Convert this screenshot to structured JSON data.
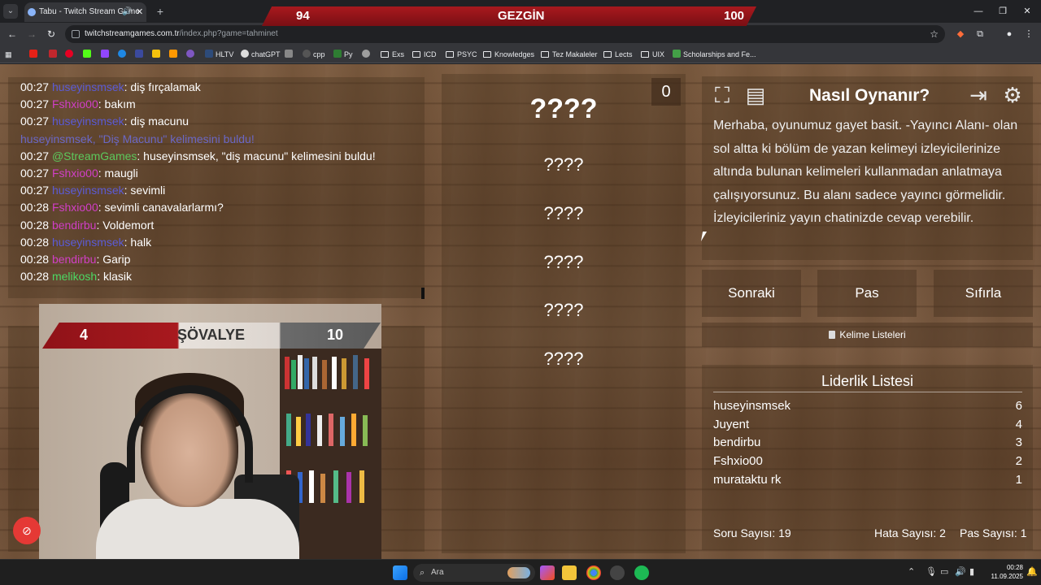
{
  "browser": {
    "tab_title": "Tabu - Twitch Stream Game",
    "url_host": "twitchstreamgames.com.tr",
    "url_path": "/index.php?game=tahminet",
    "bookmarks": [
      "HLTV",
      "chatGPT",
      "cpp",
      "Py",
      "Exs",
      "ICD",
      "PSYC",
      "Knowledges",
      "Tez Makaleler",
      "Lects",
      "UIX",
      "Scholarships and Fe..."
    ]
  },
  "top_score": {
    "left": "94",
    "title": "GEZGİN",
    "right": "100"
  },
  "chat": [
    {
      "time": "00:27",
      "user": "huseyinsmsek",
      "user_class": "u-blue",
      "sep": ":",
      "msg": " diş fırçalamak"
    },
    {
      "time": "00:27",
      "user": "Fshxio00",
      "user_class": "u-pink",
      "sep": ":",
      "msg": " bakım"
    },
    {
      "time": "00:27",
      "user": "huseyinsmsek",
      "user_class": "u-blue",
      "sep": ":",
      "msg": " diş macunu"
    },
    {
      "time": "",
      "user": "huseyinsmsek, \"Diş Macunu\" kelimesini buldu!",
      "user_class": "u-blue-faint",
      "sep": "",
      "msg": ""
    },
    {
      "time": "00:27",
      "user": "@StreamGames",
      "user_class": "u-green-faint",
      "sep": ":",
      "msg": " huseyinsmsek, \"diş macunu\" kelimesini buldu!"
    },
    {
      "time": "00:27",
      "user": "Fshxio00",
      "user_class": "u-pink",
      "sep": ":",
      "msg": " maugli"
    },
    {
      "time": "00:27",
      "user": "huseyinsmsek",
      "user_class": "u-blue",
      "sep": ":",
      "msg": " sevimli"
    },
    {
      "time": "00:28",
      "user": "Fshxio00",
      "user_class": "u-pink",
      "sep": ":",
      "msg": " sevimli canavalarlarmı?"
    },
    {
      "time": "00:28",
      "user": "bendirbu",
      "user_class": "u-pink",
      "sep": ":",
      "msg": " Voldemort"
    },
    {
      "time": "00:28",
      "user": "huseyinsmsek",
      "user_class": "u-blue",
      "sep": ":",
      "msg": " halk"
    },
    {
      "time": "00:28",
      "user": "bendirbu",
      "user_class": "u-pink",
      "sep": ":",
      "msg": " Garip"
    },
    {
      "time": "00:28",
      "user": "melikosh",
      "user_class": "u-green",
      "sep": ":",
      "msg": " klasik"
    }
  ],
  "cam_score": {
    "left": "4",
    "title": "ŞÖVALYE",
    "right": "10"
  },
  "counter": "0",
  "words": {
    "main": "????",
    "forbidden": [
      "????",
      "????",
      "????",
      "????",
      "????"
    ]
  },
  "howto": {
    "title": "Nasıl Oynanır?",
    "text": "Merhaba, oyunumuz gayet basit. -Yayıncı Alanı- olan sol altta ki bölüm de yazan kelimeyi izleyicilerinize altında bulunan kelimeleri kullanmadan anlatmaya çalışıyorsunuz. Bu alanı sadece yayıncı görmelidir. İzleyicileriniz yayın chatinizde cevap verebilir."
  },
  "actions": {
    "next": "Sonraki",
    "pass": "Pas",
    "reset": "Sıfırla"
  },
  "wordlist_label": "Kelime Listeleri",
  "leaderboard": {
    "title": "Liderlik Listesi",
    "rows": [
      {
        "name": "huseyinsmsek",
        "score": "6"
      },
      {
        "name": "Juyent",
        "score": "4"
      },
      {
        "name": "bendirbu",
        "score": "3"
      },
      {
        "name": "Fshxio00",
        "score": "2"
      },
      {
        "name": "murataktu rk",
        "score": "1"
      }
    ]
  },
  "stats": {
    "questions": "Soru Sayısı: 19",
    "errors": "Hata Sayısı: 2",
    "passes": "Pas Sayısı: 1"
  },
  "taskbar": {
    "search": "Ara",
    "time": "00:28",
    "date": "11.09.2025"
  }
}
